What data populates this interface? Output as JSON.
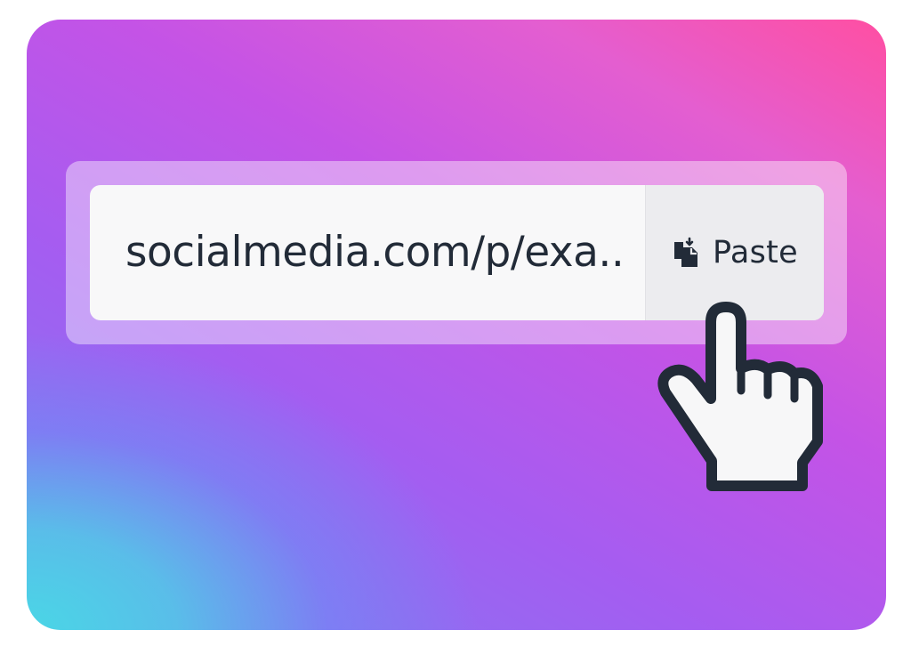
{
  "url_field": {
    "value": "socialmedia.com/p/exa.."
  },
  "paste_button": {
    "label": "Paste",
    "icon": "clipboard-icon"
  },
  "cursor": {
    "icon": "hand-pointer-cursor-icon"
  },
  "colors": {
    "gradient_teal": "#4ad6e6",
    "gradient_purple": "#a45df1",
    "gradient_pink": "#ff4fa2",
    "text": "#222b38",
    "field_bg": "#f8f8f9",
    "button_bg": "#ececef"
  }
}
